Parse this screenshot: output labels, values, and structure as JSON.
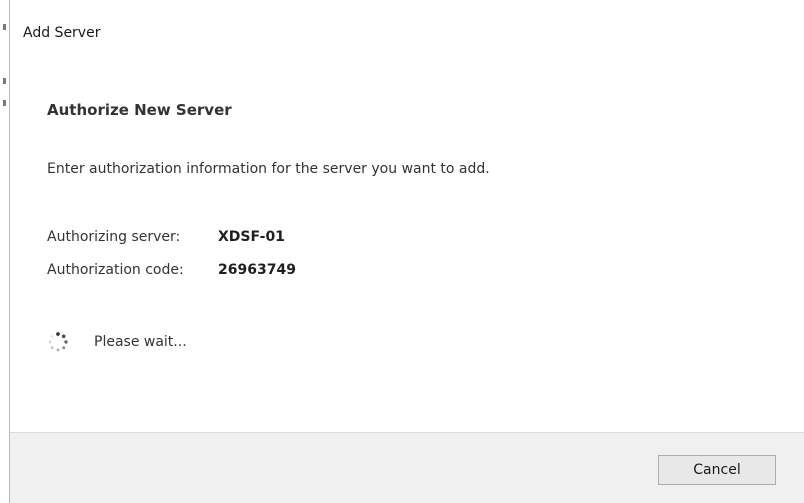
{
  "window": {
    "title": "Add Server"
  },
  "main": {
    "heading": "Authorize New Server",
    "instruction": "Enter authorization information for the server you want to add.",
    "authorizing_server": {
      "label": "Authorizing server:",
      "value": "XDSF-01"
    },
    "authorization_code": {
      "label": "Authorization code:",
      "value": "26963749"
    },
    "status": {
      "icon": "spinner-icon",
      "text": "Please wait..."
    }
  },
  "footer": {
    "cancel_label": "Cancel"
  },
  "colors": {
    "text": "#333333",
    "footer_background": "#f0f0f0",
    "button_background": "#e8e8e8",
    "button_border": "#adadad"
  }
}
